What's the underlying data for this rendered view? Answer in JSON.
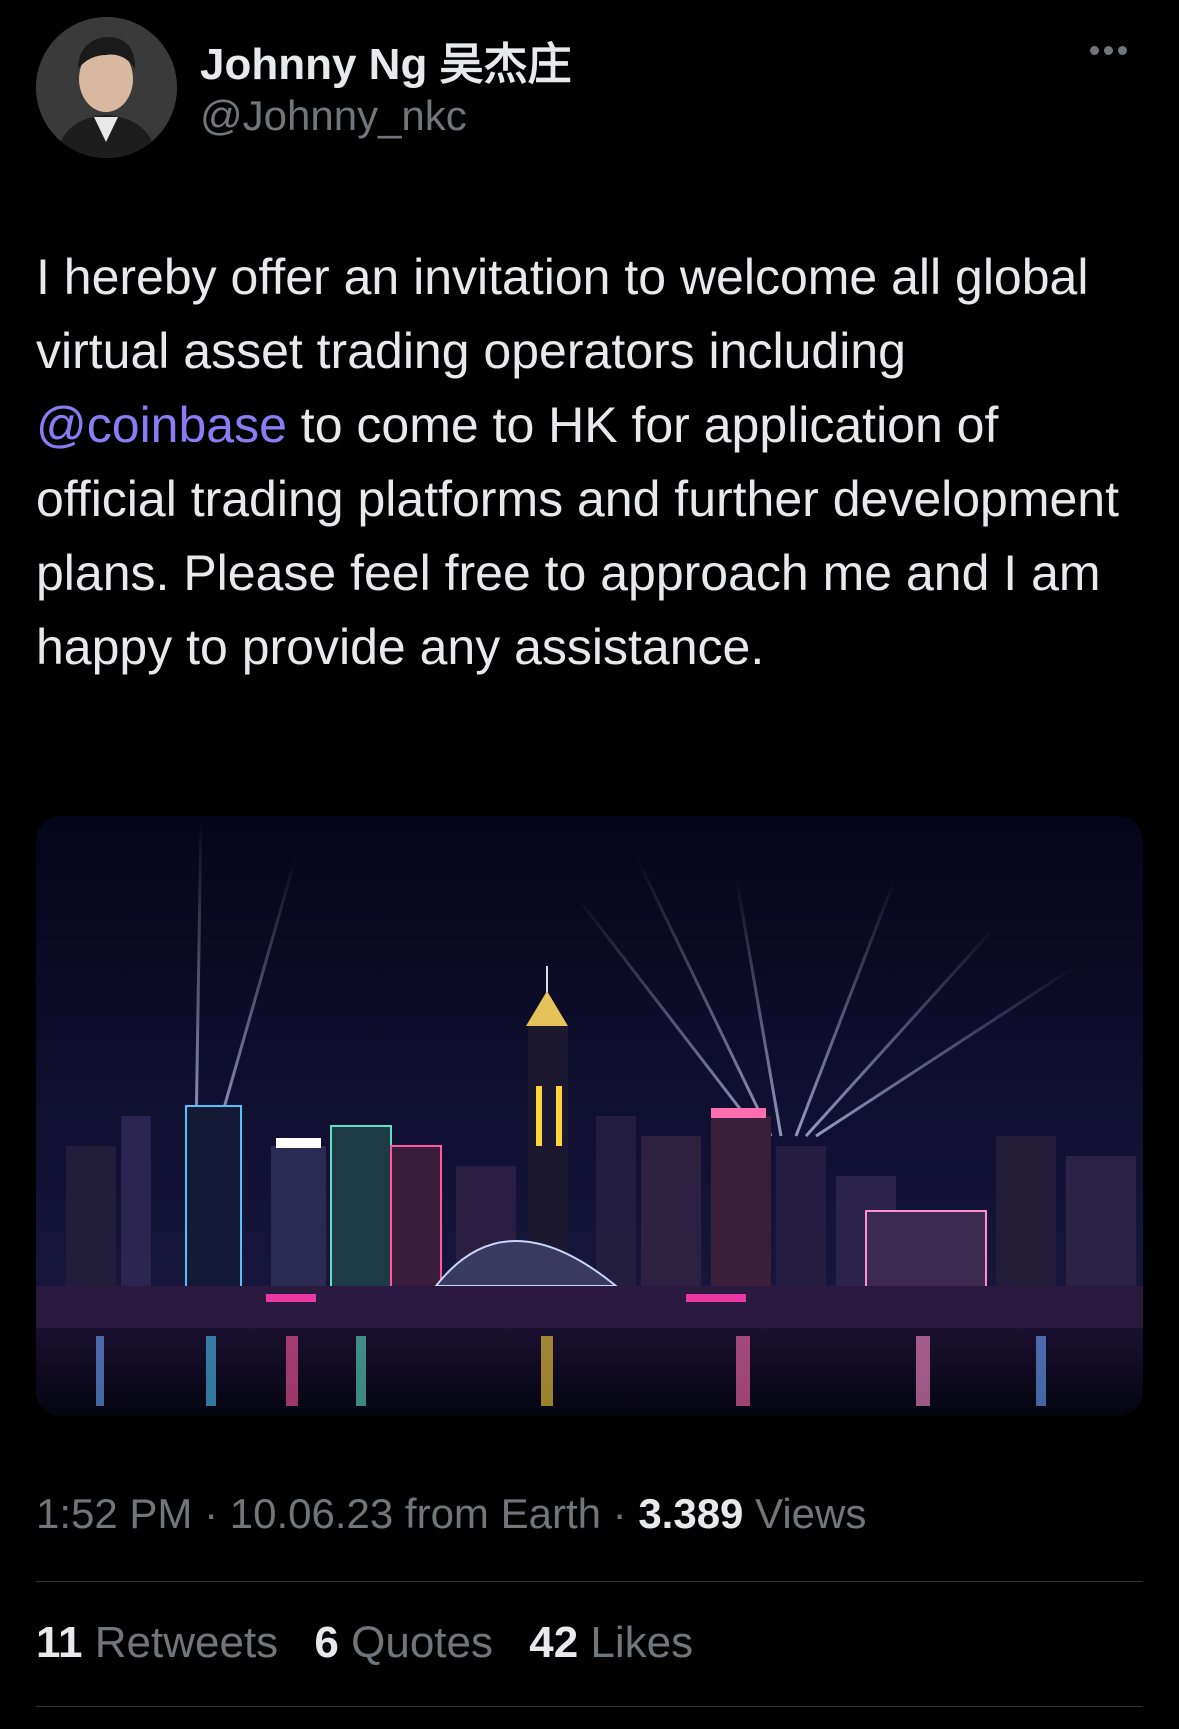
{
  "author": {
    "name": "Johnny Ng 吴杰庄",
    "handle": "@Johnny_nkc"
  },
  "tweet": {
    "text_before": "I hereby offer an invitation to welcome all global virtual asset trading operators including ",
    "mention": "@coinbase",
    "text_after": " to come to HK for application of official trading platforms and further development plans. Please feel free to approach me and I am happy to provide any assistance."
  },
  "meta": {
    "time": "1:52 PM",
    "date": "10.06.23",
    "source": "from Earth",
    "views_count": "3.389",
    "views_label": "Views"
  },
  "stats": {
    "retweets_count": "11",
    "retweets_label": "Retweets",
    "quotes_count": "6",
    "quotes_label": "Quotes",
    "likes_count": "42",
    "likes_label": "Likes"
  },
  "colors": {
    "background": "#000000",
    "text": "#e7e9ea",
    "secondary": "#71767b",
    "mention": "#8b7cf6"
  },
  "icons": {
    "more": "more-horizontal-icon"
  }
}
